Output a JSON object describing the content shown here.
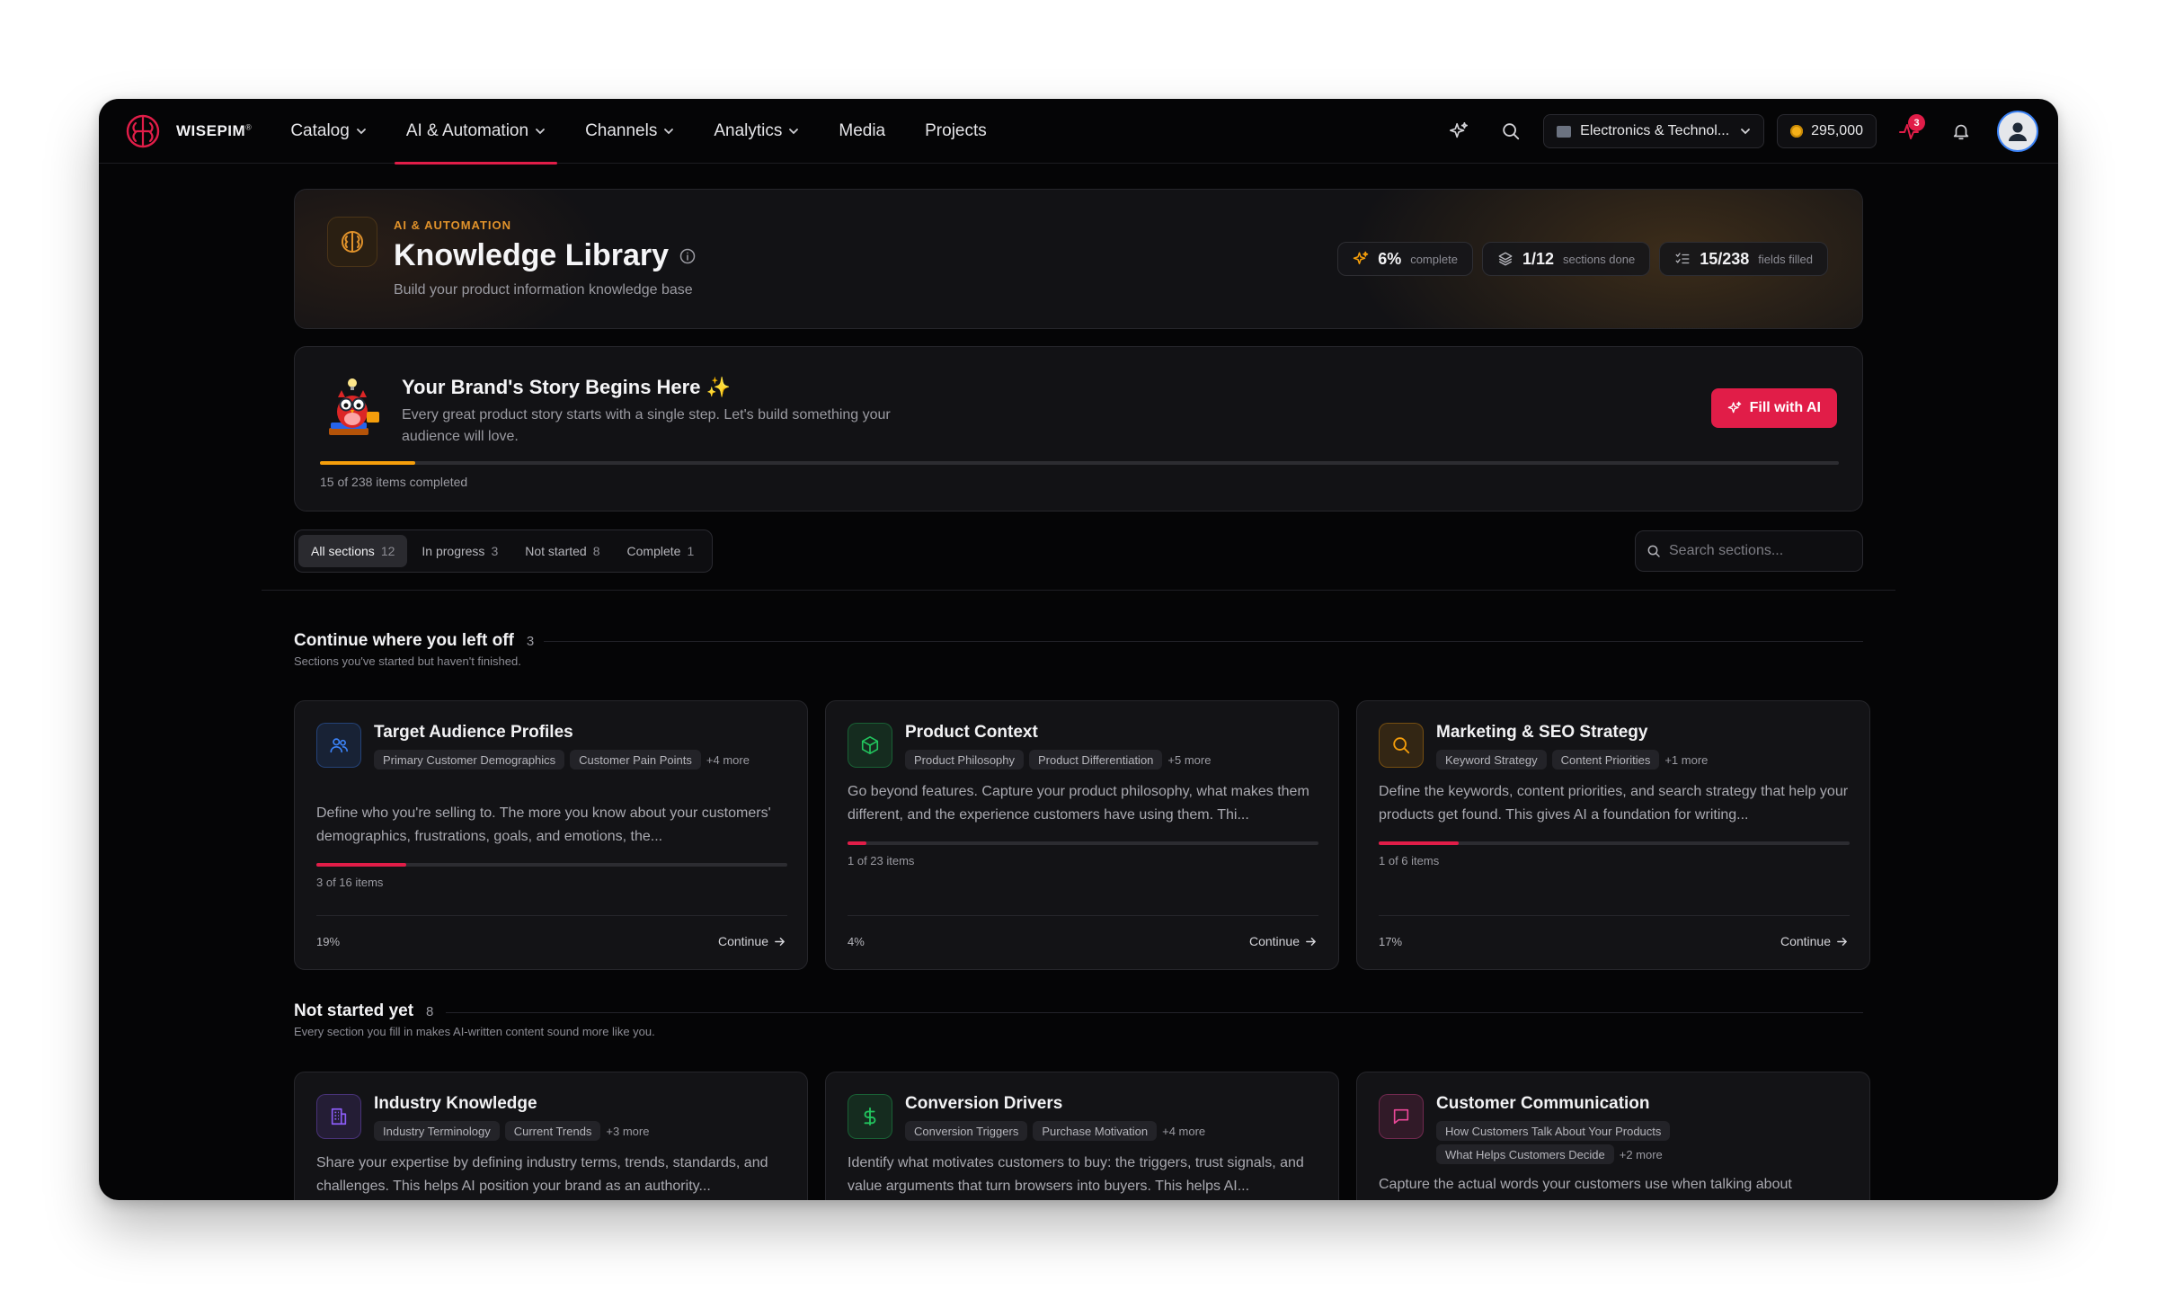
{
  "brand": {
    "name": "WISEPIM"
  },
  "nav": [
    {
      "label": "Catalog",
      "dropdown": true,
      "active": false
    },
    {
      "label": "AI & Automation",
      "dropdown": true,
      "active": true
    },
    {
      "label": "Channels",
      "dropdown": true,
      "active": false
    },
    {
      "label": "Analytics",
      "dropdown": true,
      "active": false
    },
    {
      "label": "Media",
      "dropdown": false,
      "active": false
    },
    {
      "label": "Projects",
      "dropdown": false,
      "active": false
    }
  ],
  "toolbar": {
    "workspace": "Electronics & Technol...",
    "credits": "295,000",
    "activity_badge": "3"
  },
  "header": {
    "eyebrow": "AI & AUTOMATION",
    "title": "Knowledge Library",
    "subtitle": "Build your product information knowledge base",
    "stats": [
      {
        "value": "6%",
        "label": "complete"
      },
      {
        "value": "1/12",
        "label": "sections done"
      },
      {
        "value": "15/238",
        "label": "fields filled"
      }
    ]
  },
  "story": {
    "title": "Your Brand's Story Begins Here ✨",
    "description": "Every great product story starts with a single step. Let's build something your audience will love.",
    "button": "Fill with AI",
    "progress": 0.063,
    "count_text": "15 of 238 items completed"
  },
  "filters": {
    "tabs": [
      {
        "label": "All sections",
        "count": "12",
        "active": true
      },
      {
        "label": "In progress",
        "count": "3",
        "active": false
      },
      {
        "label": "Not started",
        "count": "8",
        "active": false
      },
      {
        "label": "Complete",
        "count": "1",
        "active": false
      }
    ],
    "search_placeholder": "Search sections..."
  },
  "continue_section": {
    "title": "Continue where you left off",
    "count": "3",
    "subtitle": "Sections you've started but haven't finished.",
    "cards": [
      {
        "title": "Target Audience Profiles",
        "icon": "users-icon",
        "color": "#3b82f6",
        "tags": [
          "Primary Customer Demographics",
          "Customer Pain Points"
        ],
        "more": "+4 more",
        "description": "Define who you're selling to. The more you know about your customers' demographics, frustrations, goals, and emotions, the...",
        "progress": 0.19,
        "items": "3 of 16 items",
        "percent": "19%",
        "action": "Continue"
      },
      {
        "title": "Product Context",
        "icon": "box-icon",
        "color": "#22c55e",
        "tags": [
          "Product Philosophy",
          "Product Differentiation"
        ],
        "more": "+5 more",
        "description": "Go beyond features. Capture your product philosophy, what makes them different, and the experience customers have using them. Thi...",
        "progress": 0.04,
        "items": "1 of 23 items",
        "percent": "4%",
        "action": "Continue"
      },
      {
        "title": "Marketing & SEO Strategy",
        "icon": "search-icon",
        "color": "#f59e0b",
        "tags": [
          "Keyword Strategy",
          "Content Priorities"
        ],
        "more": "+1 more",
        "description": "Define the keywords, content priorities, and search strategy that help your products get found. This gives AI a foundation for writing...",
        "progress": 0.17,
        "items": "1 of 6 items",
        "percent": "17%",
        "action": "Continue"
      }
    ]
  },
  "not_started_section": {
    "title": "Not started yet",
    "count": "8",
    "subtitle": "Every section you fill in makes AI-written content sound more like you.",
    "cards": [
      {
        "title": "Industry Knowledge",
        "icon": "building-icon",
        "color": "#8b5cf6",
        "tags": [
          "Industry Terminology",
          "Current Trends"
        ],
        "more": "+3 more",
        "description": "Share your expertise by defining industry terms, trends, standards, and challenges. This helps AI position your brand as an authority..."
      },
      {
        "title": "Conversion Drivers",
        "icon": "dollar-icon",
        "color": "#22c55e",
        "tags": [
          "Conversion Triggers",
          "Purchase Motivation"
        ],
        "more": "+4 more",
        "description": "Identify what motivates customers to buy: the triggers, trust signals, and value arguments that turn browsers into buyers. This helps AI..."
      },
      {
        "title": "Customer Communication",
        "icon": "message-icon",
        "color": "#ec4899",
        "tags": [
          "How Customers Talk About Your Products",
          "What Helps Customers Decide"
        ],
        "more": "+2 more",
        "description": "Capture the actual words your customers use when talking about"
      }
    ]
  }
}
